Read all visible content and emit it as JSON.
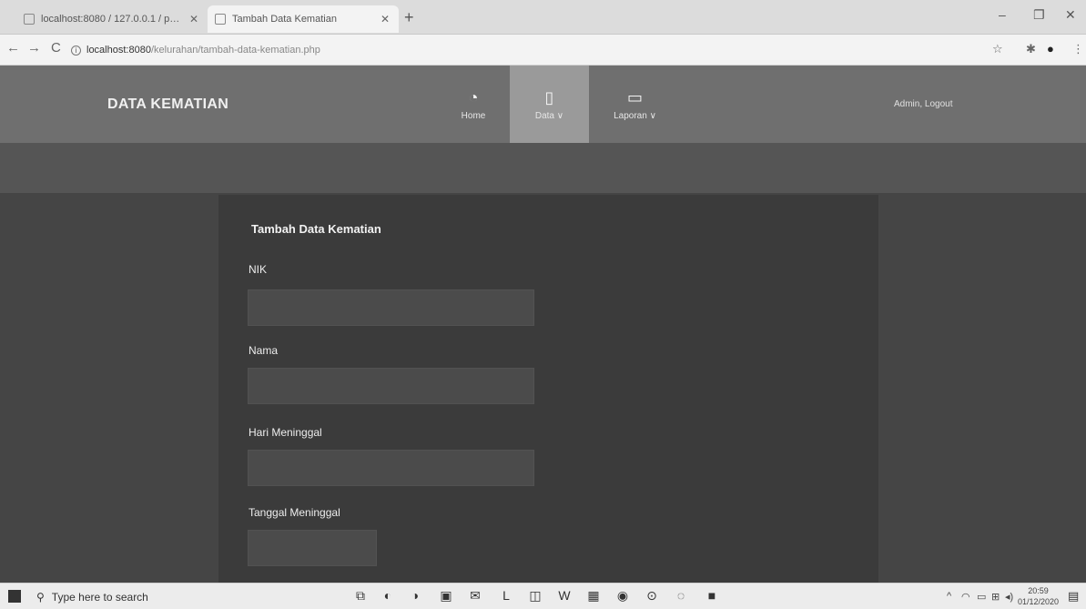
{
  "browser": {
    "tabs": [
      {
        "label": "localhost:8080 / 127.0.0.1 / pd_u"
      },
      {
        "label": "Tambah Data Kematian"
      }
    ],
    "new_tab_icon": "plus-icon",
    "url_host": "localhost:8080",
    "url_path": "/kelurahan/tambah-data-kematian.php",
    "window_controls": [
      "minimize-icon",
      "maximize-icon",
      "close-icon"
    ]
  },
  "navbar": {
    "brand": "DATA KEMATIAN",
    "items": [
      {
        "label": "Home",
        "icon": "dashboard-icon"
      },
      {
        "label": "Data ∨",
        "icon": "document-icon"
      },
      {
        "label": "Laporan ∨",
        "icon": "monitor-icon"
      }
    ],
    "user": "Admin, Logout"
  },
  "form": {
    "title": "Tambah Data Kematian",
    "fields": [
      {
        "label": "NIK",
        "value": ""
      },
      {
        "label": "Nama",
        "value": ""
      },
      {
        "label": "Hari Meninggal",
        "value": ""
      },
      {
        "label": "Tanggal Meninggal",
        "value": ""
      }
    ]
  },
  "taskbar": {
    "search_placeholder": "Type here to search",
    "time": "20:59",
    "date": "01/12/2020"
  }
}
